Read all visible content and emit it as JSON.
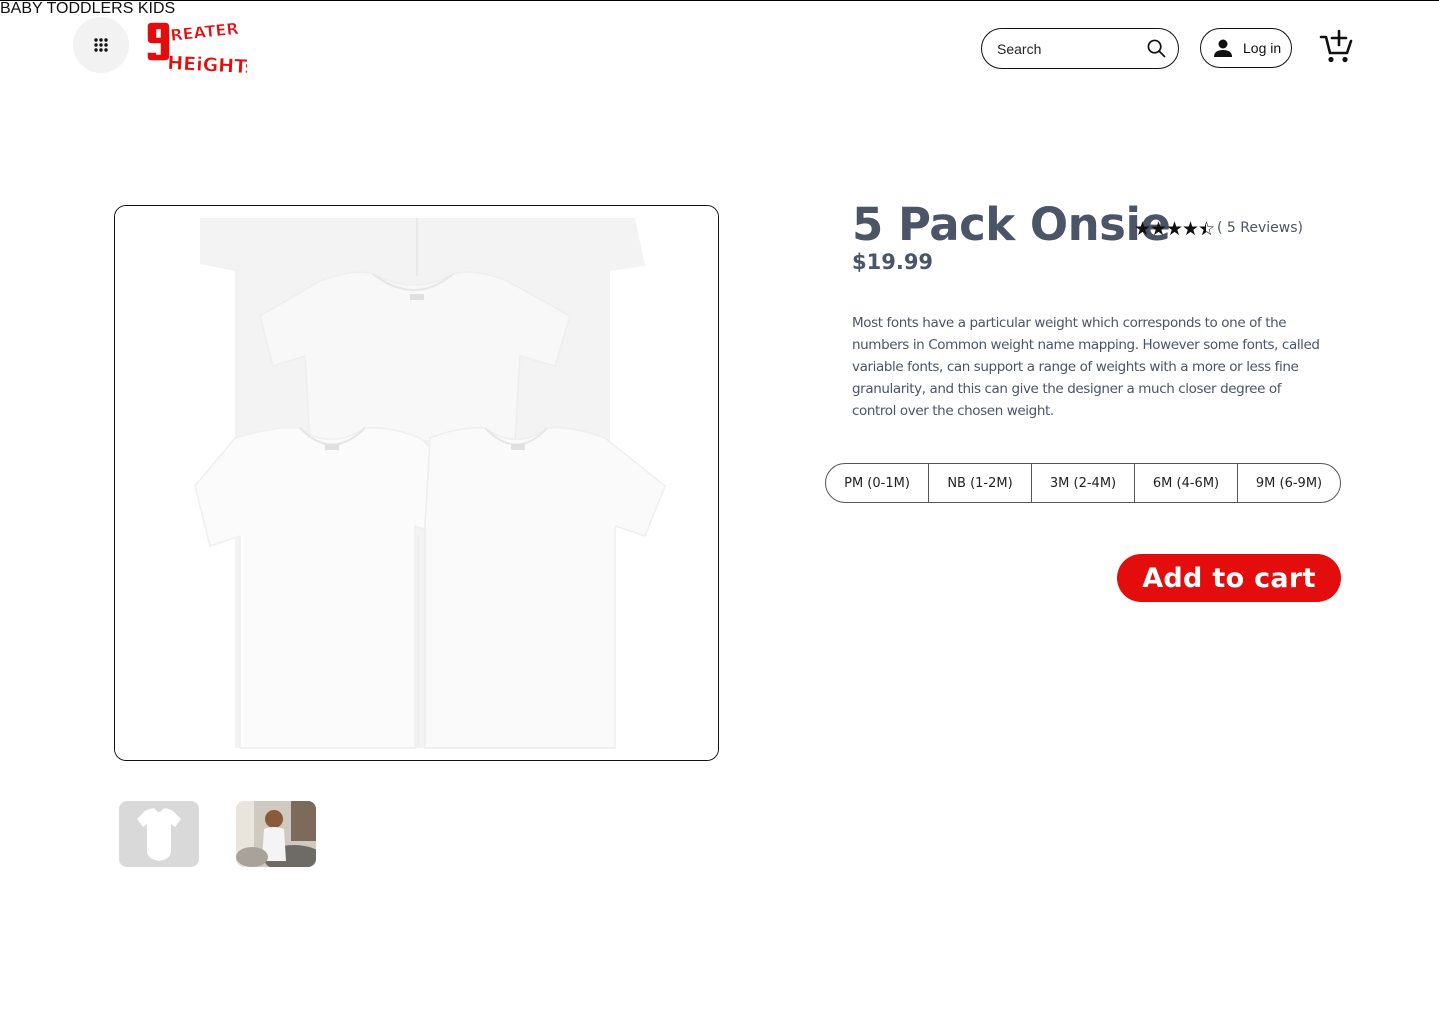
{
  "header": {
    "menu_icon": "grid-dots-icon",
    "logo_text": "GREATER HEIGHTS",
    "nav": [
      "BABY",
      "TODDLERS",
      "KIDS"
    ],
    "search_placeholder": "Search",
    "login_label": "Log in",
    "cart_icon": "add-to-cart-icon"
  },
  "product": {
    "title": "5 Pack Onsie",
    "rating": 4.5,
    "reviews_text": "( 5 Reviews)",
    "price": "$19.99",
    "description": "Most fonts have a particular weight which corresponds to one of the numbers in Common weight name mapping. However some fonts, called variable fonts, can support a range of weights with a more or less fine granularity, and this can give the designer a much closer degree of control over the chosen weight.",
    "sizes": [
      "PM (0-1M)",
      "NB (1-2M)",
      "3M (2-4M)",
      "6M (4-6M)",
      "9M (6-9M)"
    ],
    "add_to_cart_label": "Add to cart"
  },
  "colors": {
    "accent": "#e30d0d",
    "text_slate": "#4b5567"
  }
}
